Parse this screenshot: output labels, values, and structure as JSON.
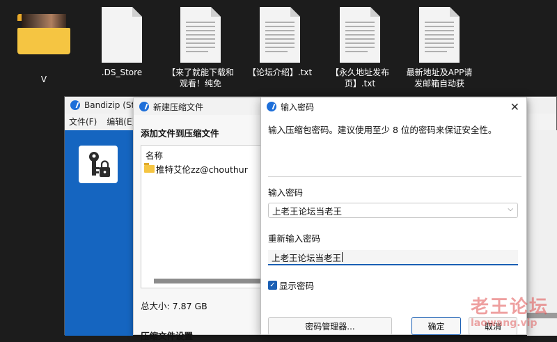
{
  "desktop": {
    "icons": [
      {
        "label": "V"
      },
      {
        "label": ".DS_Store"
      },
      {
        "label": "【来了就能下载和观看！纯免"
      },
      {
        "label": "【论坛介绍】.txt"
      },
      {
        "label": "【永久地址发布页】.txt"
      },
      {
        "label": "最新地址及APP请发邮箱自动获"
      }
    ]
  },
  "bandizip": {
    "title": "Bandizip (Star",
    "menu": [
      "文件(F)",
      "编辑(E)"
    ]
  },
  "new_archive": {
    "title": "新建压缩文件",
    "heading": "添加文件到压缩文件",
    "list_header": "名称",
    "item": "推特艾伦zz@chouthur",
    "total_size": "总大小: 7.87 GB",
    "settings_heading": "压缩文件设置"
  },
  "password_dialog": {
    "title": "输入密码",
    "description": "输入压缩包密码。建议使用至少 8 位的密码来保证安全性。",
    "password_label": "输入密码",
    "password_value": "上老王论坛当老王",
    "reenter_label": "重新输入密码",
    "reenter_value": "上老王论坛当老王",
    "show_password": "显示密码",
    "show_password_checked": true,
    "manager_button": "密码管理器...",
    "ok_button": "确定",
    "cancel_button": "取消"
  },
  "watermark": {
    "text": "老王论坛",
    "url": "laowang.vip"
  },
  "colors": {
    "accent": "#1e6fd9",
    "sidebar_blue": "#1565c0",
    "focus_underline": "#1a5fb4",
    "watermark": "#e05050"
  }
}
